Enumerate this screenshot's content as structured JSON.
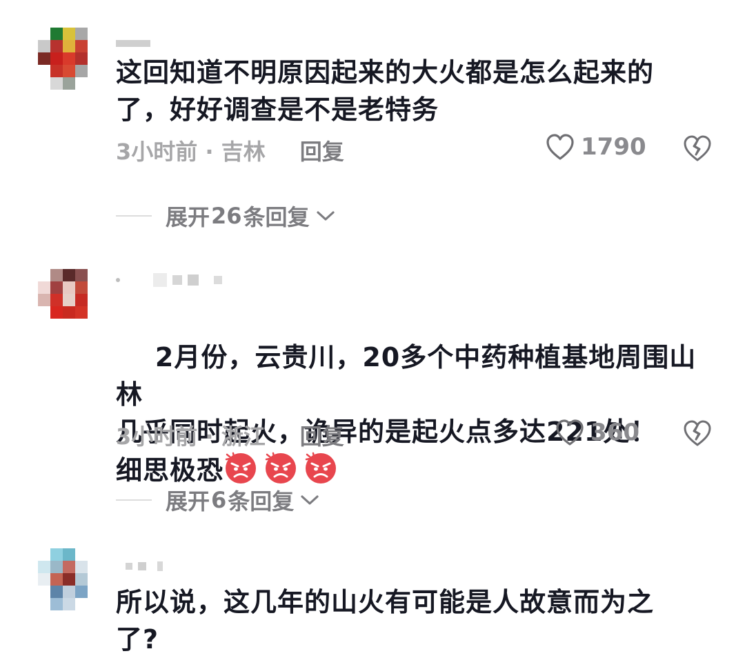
{
  "comments": [
    {
      "text": "这回知道不明原因起来的大火都是怎么起来的\n了，好好调查是不是老特务",
      "time_location": "3小时前 · 吉林",
      "reply_label": "回复",
      "likes": "1790",
      "expand": {
        "prefix": "展开",
        "count": "26",
        "suffix": "条回复"
      }
    },
    {
      "text": "2月份，云贵川，20多个中药种植基地周围山林\n几乎同时起火，诡异的是起火点多达221处！\n细思极恐",
      "emoji_name": "angry-face-emoji",
      "time_location": "3小时前 · 浙江",
      "reply_label": "回复",
      "likes": "360",
      "expand": {
        "prefix": "展开",
        "count": "6",
        "suffix": "条回复"
      }
    },
    {
      "text": "所以说，这几年的山火有可能是人故意而为之\n了?"
    }
  ],
  "colors": {
    "text": "#161823",
    "meta": "#a6a6a8",
    "action": "#7c7c80",
    "emoji": "#e8464e"
  },
  "icons": [
    "heart-outline-icon",
    "broken-heart-icon",
    "chevron-down-icon"
  ]
}
